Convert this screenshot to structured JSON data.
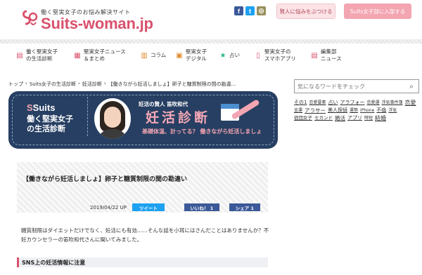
{
  "header": {
    "tagline": "働く堅実女子のお悩み解決サイト",
    "site_name": "Suits-woman.jp",
    "btn_consult": "賢人に悩みをぶつける",
    "btn_join": "Suits女子部に入部する"
  },
  "social": {
    "facebook": "f",
    "twitter": "t",
    "other": "◎"
  },
  "colors": {
    "brand_pink": "#d9516c",
    "navy": "#273f62",
    "light_pink": "#f3a5b2",
    "twitter": "#1da1f2",
    "facebook": "#3b5998"
  },
  "nav": [
    {
      "icon": "clipboard-icon",
      "label1": "働く堅実女子",
      "label2": "の生活診断"
    },
    {
      "icon": "newspaper-icon",
      "label1": "堅実女子ニュース",
      "label2": "＆まとめ"
    },
    {
      "icon": "book-icon",
      "label1": "コラム",
      "label2": ""
    },
    {
      "icon": "bag-icon",
      "label1": "堅実女子",
      "label2": "デジタル"
    },
    {
      "icon": "star-icon",
      "label1": "占い",
      "label2": ""
    },
    {
      "icon": "smartphone-icon",
      "label1": "堅実女子の",
      "label2": "スマホアプリ"
    },
    {
      "icon": "document-icon",
      "label1": "編集部",
      "label2": "ニュース"
    }
  ],
  "breadcrumb": [
    "トップ",
    "›",
    "Suits女子の生活診断",
    "›",
    "妊活診断",
    "›",
    "【働きながら妊活しましょ】卵子と糖質制限の間の勘違..."
  ],
  "banner": {
    "logo": "Suits",
    "caption1": "働く堅実女子",
    "caption2": "の生活診断",
    "sub": "妊活の賢人 笛吹和代",
    "title": "妊活診断",
    "tagline": "基礎体温、計ってる？ 働きながら妊活しましょ"
  },
  "article": {
    "title": "【働きながら妊活しましょ】卵子と糖質制限の間の勘違い",
    "date": "2019/04/22 UP",
    "tweet": "ツイート",
    "like": "いいね！ 1",
    "share": "シェア 1",
    "body": "糖質制限はダイエットだけでなく、妊活にも有効……そんな話を小耳にはさんだことはありませんか？不妊カウンセラーの笛吹和代さんに聞いてみました。",
    "h2": "SNS上の妊活情報に注意"
  },
  "sidebar": {
    "search_placeholder": "気になるワードをチェック",
    "tags": [
      "その1",
      "恋愛要素",
      "占い",
      "アラフォー",
      "恋愛運",
      "浮気事件簿",
      "恋愛",
      "金運",
      "アラサー",
      "美人探偵",
      "運勢",
      "iPhone",
      "不倫",
      "浮気",
      "宿団女子",
      "セカンド",
      "婚活",
      "アプリ",
      "時短",
      "結婚"
    ]
  }
}
